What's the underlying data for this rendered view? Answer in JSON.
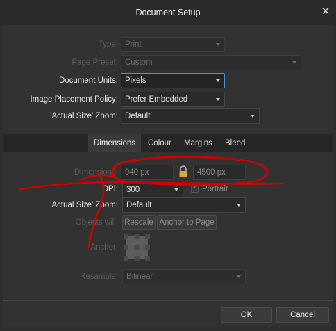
{
  "window": {
    "title": "Document Setup",
    "close_glyph": "✕"
  },
  "top_form": {
    "type_label": "Type:",
    "type_value": "Print",
    "preset_label": "Page Preset:",
    "preset_value": "Custom",
    "units_label": "Document Units:",
    "units_value": "Pixels",
    "placement_label": "Image Placement Policy:",
    "placement_value": "Prefer Embedded",
    "zoom_label": "'Actual Size' Zoom:",
    "zoom_value": "Default"
  },
  "tabs": [
    "Dimensions",
    "Colour",
    "Margins",
    "Bleed"
  ],
  "dimensions": {
    "dim_label": "Dimensions:",
    "width_value": "940 px",
    "height_value": "4500 px",
    "dpi_label": "DPI:",
    "dpi_value": "300",
    "portrait_label": "Portrait",
    "zoom_label": "'Actual Size' Zoom:",
    "zoom_value": "Default",
    "objects_label": "Objects will:",
    "rescale_label": "Rescale",
    "anchor_btn_label": "Anchor to Page",
    "anchor_label": "Anchor:",
    "resample_label": "Resample:",
    "resample_value": "Bilinear"
  },
  "footer": {
    "ok_label": "OK",
    "cancel_label": "Cancel"
  },
  "colors": {
    "annotation": "#d40000",
    "accent": "#4a8fd8",
    "lock": "#d9a441"
  },
  "icons": {
    "lock": "padlock-icon",
    "close": "close-icon",
    "anchor": "anchor-grid-icon",
    "check": "checkmark-icon"
  }
}
